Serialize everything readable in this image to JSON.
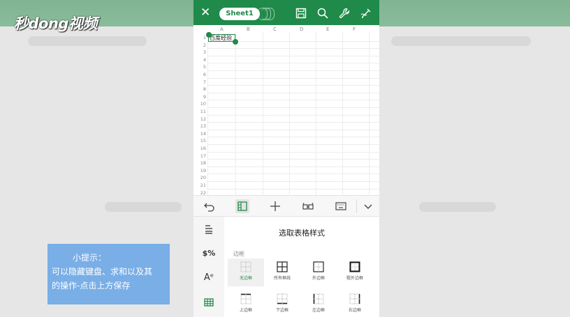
{
  "overlay": {
    "logo_text": "秒dong视频",
    "tip": {
      "title": "小提示：",
      "line1": "可以隐藏键盘、求和以及其",
      "line2": "的操作-点击上方保存"
    }
  },
  "app": {
    "colors": {
      "accent": "#1f8a49",
      "selection": "#1f8a49"
    },
    "topbar": {
      "close_icon": "close-icon",
      "sheet_tab_label": "Sheet1",
      "icons": [
        "save-icon",
        "search-icon",
        "wrench-icon",
        "pen-icon"
      ]
    },
    "sheet": {
      "columns": [
        "A",
        "B",
        "C",
        "D",
        "E",
        "F"
      ],
      "rows": [
        "1",
        "2",
        "3",
        "4",
        "5",
        "6",
        "7",
        "8",
        "9",
        "10",
        "11",
        "12",
        "13",
        "14",
        "15",
        "16",
        "17",
        "18",
        "19",
        "20",
        "21",
        "22"
      ],
      "selected_cell_value": "百度经验"
    },
    "toolbar": {
      "icons": [
        "undo-icon",
        "format-panel-icon",
        "insert-plus-icon",
        "glasses-icon",
        "keyboard-icon",
        "chevron-down-icon"
      ]
    },
    "format_panel": {
      "side_icons": [
        "align-icon",
        "number-format-icon",
        "font-icon",
        "table-style-icon"
      ],
      "number_format_glyph": "$%",
      "font_glyph": "Aᵉ",
      "title": "选取表格样式",
      "section_label": "边框",
      "border_options": [
        {
          "label": "无边框",
          "icon": "no-border-icon"
        },
        {
          "label": "所有框线",
          "icon": "all-borders-icon"
        },
        {
          "label": "外边框",
          "icon": "outside-border-icon"
        },
        {
          "label": "粗外边框",
          "icon": "thick-outside-border-icon"
        },
        {
          "label": "上边框",
          "icon": "top-border-icon"
        },
        {
          "label": "下边框",
          "icon": "bottom-border-icon"
        },
        {
          "label": "左边框",
          "icon": "left-border-icon"
        },
        {
          "label": "右边框",
          "icon": "right-border-icon"
        }
      ]
    }
  }
}
